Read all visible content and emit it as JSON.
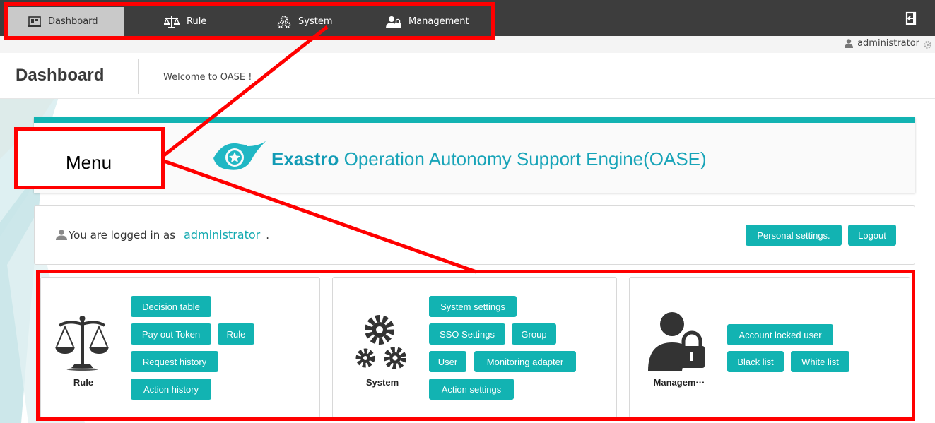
{
  "nav": {
    "items": [
      {
        "label": "Dashboard",
        "icon": "dashboard-icon",
        "active": true
      },
      {
        "label": "Rule",
        "icon": "scales-icon",
        "active": false
      },
      {
        "label": "System",
        "icon": "gears-icon",
        "active": false
      },
      {
        "label": "Management",
        "icon": "user-lock-icon",
        "active": false
      }
    ],
    "logout_icon": "exit-icon"
  },
  "user": {
    "name": "administrator",
    "icon": "user-icon",
    "settings_icon": "gear-icon"
  },
  "header": {
    "title": "Dashboard",
    "welcome": "Welcome to OASE !"
  },
  "hero": {
    "brand": "Exastro",
    "title": " Operation Autonomy Support Engine(OASE)"
  },
  "login": {
    "prefix": "You are logged in as",
    "username": "administrator",
    "suffix": ".",
    "personal_settings_label": "Personal settings.",
    "logout_label": "Logout"
  },
  "panels": {
    "rule": {
      "label": "Rule",
      "icon": "scales-icon",
      "buttons": [
        "Decision table",
        "Pay out Token",
        "Rule",
        "Request history",
        "Action history"
      ]
    },
    "system": {
      "label": "System",
      "icon": "gears-icon",
      "buttons": [
        "System settings",
        "SSO Settings",
        "Group",
        "User",
        "Monitoring adapter",
        "Action settings"
      ]
    },
    "management": {
      "label": "Managem···",
      "icon": "user-lock-icon",
      "buttons": [
        "Account locked user",
        "Black list",
        "White list"
      ]
    }
  },
  "annotation": {
    "label": "Menu",
    "color": "#ff0000"
  },
  "colors": {
    "accent": "#12b3b2",
    "topbar": "#3d3d3d",
    "link": "#12a9b0"
  }
}
